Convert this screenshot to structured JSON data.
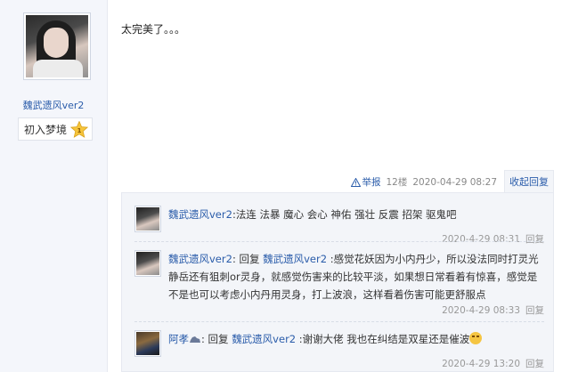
{
  "author": {
    "username": "魏武遗风ver2",
    "rank": "初入梦境",
    "rank_icon": "star-badge-icon",
    "rank_number": "1"
  },
  "post": {
    "content": "太完美了。。。",
    "report_label": "举报",
    "floor": "12楼",
    "timestamp": "2020-04-29 08:27",
    "collapse_label": "收起回复"
  },
  "replies": [
    {
      "name": "魏武遗风ver2",
      "colon": ":",
      "text": "法连 法暴 魔心 会心 神佑 强壮 反震 招架 驱鬼吧",
      "time": "2020-4-29 08:31",
      "reply_label": "回复"
    },
    {
      "name": "魏武遗风ver2",
      "colon": ":",
      "reply_prefix": " 回复 ",
      "reply_to": "魏武遗风ver2",
      "text": " :感觉花妖因为小内丹少，所以没法同时打灵光静岳还有狙刺or灵身，就感觉伤害来的比较平淡，如果想日常看着有惊喜，感觉是不是也可以考虑小内丹用灵身，打上波浪，这样看着伤害可能更舒服点",
      "time": "2020-4-29 08:33",
      "reply_label": "回复"
    },
    {
      "name": "阿孝",
      "name_icon": "bear-icon",
      "colon": ":",
      "reply_prefix": " 回复 ",
      "reply_to": "魏武遗风ver2",
      "text": " :谢谢大佬 我也在纠结是双星还是催波",
      "emoji": "grimace-emoji-icon",
      "time": "2020-4-29 13:20",
      "reply_label": "回复"
    }
  ],
  "colors": {
    "link": "#2a5caa",
    "sidebar_bg": "#f4f6fb",
    "reply_bg": "#f3f5f9"
  }
}
